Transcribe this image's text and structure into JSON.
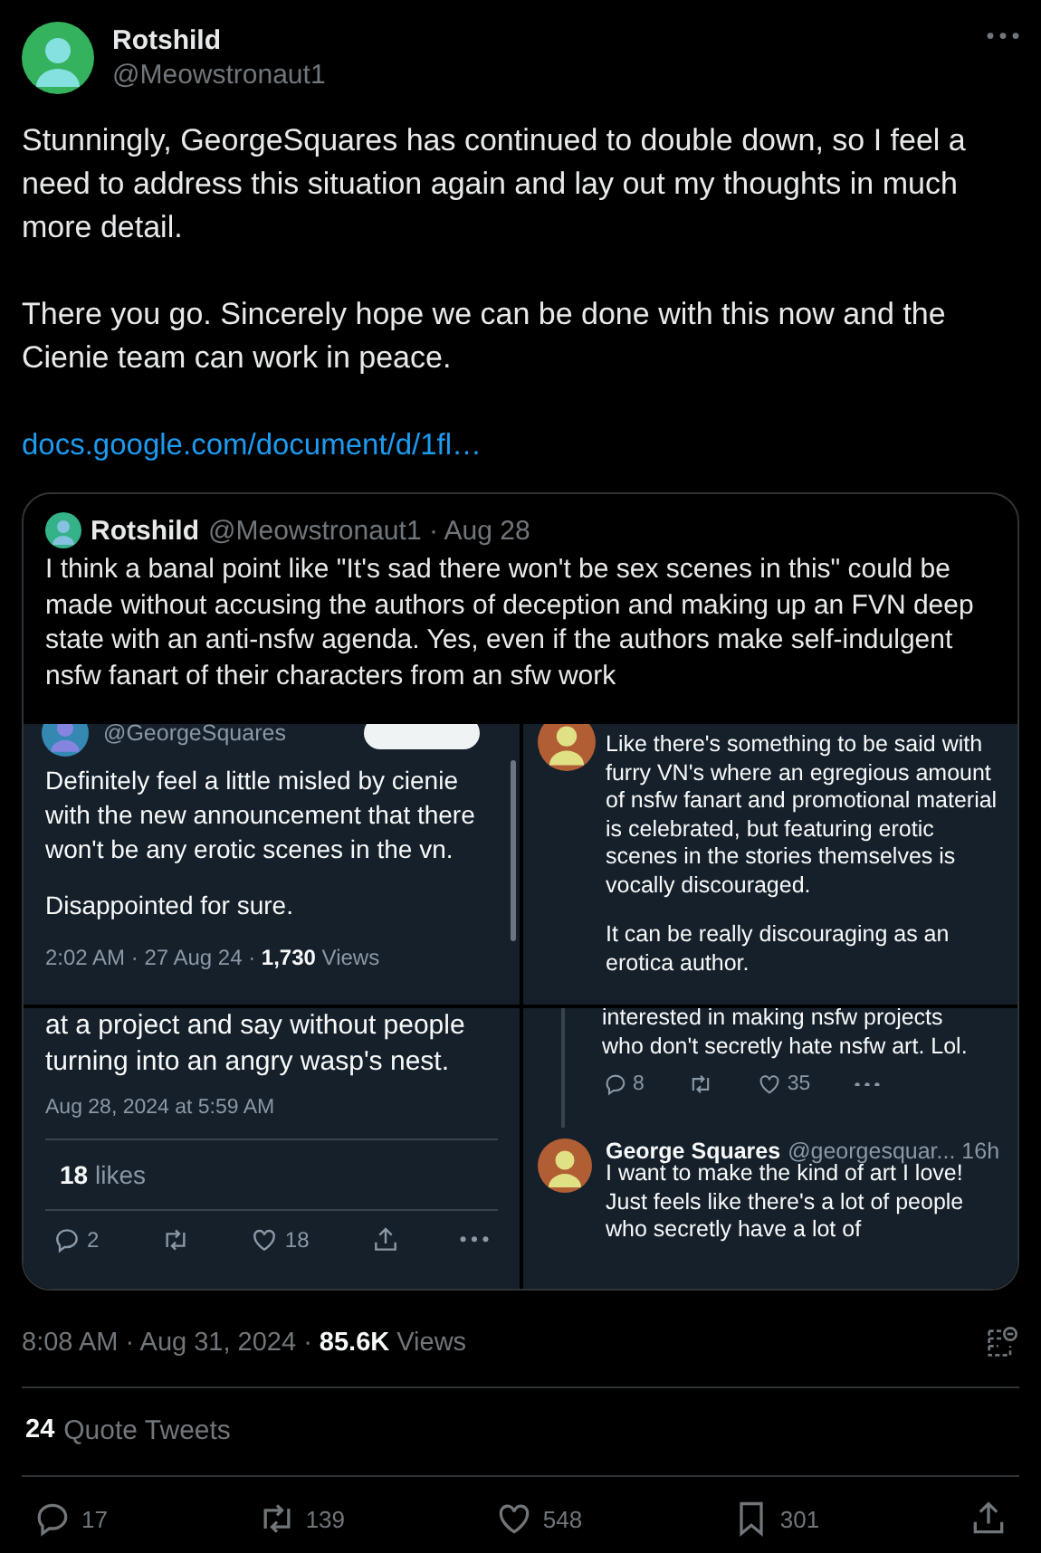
{
  "tweet": {
    "author": {
      "name": "Rotshild",
      "handle": "@Meowstronaut1"
    },
    "paragraphs": [
      "Stunningly, GeorgeSquares has continued to double down, so I feel a need to address this situation again and lay out my thoughts in much more detail.",
      "There you go. Sincerely hope we can be done with this now and the Cienie team can work in peace."
    ],
    "link": "docs.google.com/document/d/1fl…",
    "quote": {
      "name": "Rotshild",
      "meta": "@Meowstronaut1 · Aug 28",
      "text": "I think a banal point like \"It's sad there won't be sex scenes in this\" could be made without accusing the authors of deception and making up an FVN deep state with an anti-nsfw agenda. Yes, even if the authors make self-indulgent nsfw fanart of their characters from an sfw work",
      "screenshots": [
        {
          "kind": "post_top",
          "handle": "@GeorgeSquares",
          "paragraphs": [
            "Definitely feel a little misled by cienie with the new announcement that there won't be any erotic scenes in the vn.",
            "Disappointed for sure."
          ],
          "time": "2:02 AM · 27 Aug 24 ·",
          "views": "1,730",
          "views_label": "Views"
        },
        {
          "kind": "reply_top",
          "paragraphs": [
            "Like there's something to be said with furry VN's where an egregious amount of nsfw fanart and promotional material is celebrated, but featuring erotic scenes in the stories themselves is vocally discouraged.",
            "It can be really discouraging as an erotica author."
          ]
        },
        {
          "kind": "post_bottom",
          "paragraphs": [
            "at a project and say without people turning into an angry wasp's nest."
          ],
          "time": "Aug 28, 2024 at 5:59 AM",
          "likes": "18",
          "likes_label": "likes",
          "actions": [
            {
              "kind": "reply",
              "count": "2"
            },
            {
              "kind": "retweet"
            },
            {
              "kind": "like",
              "count": "18"
            },
            {
              "kind": "share"
            },
            {
              "kind": "more"
            }
          ]
        },
        {
          "kind": "reply_bottom",
          "paragraphs": [
            "interested in making nsfw projects who don't secretly hate nsfw art. Lol."
          ],
          "actions": [
            {
              "kind": "reply",
              "count": "8"
            },
            {
              "kind": "retweet"
            },
            {
              "kind": "like",
              "count": "35"
            },
            {
              "kind": "more"
            }
          ],
          "reply": {
            "name": "George Squares",
            "meta": "@georgesquar... 16h",
            "text": "I want to make the kind of art I love! Just feels like there's a lot of people who secretly have a lot of"
          }
        }
      ]
    },
    "time": "8:08 AM · Aug 31, 2024 ·",
    "views": "85.6K",
    "views_label": "Views",
    "quote_tweets": {
      "count": "24",
      "label": "Quote Tweets"
    },
    "actions": [
      {
        "kind": "reply",
        "count": "17"
      },
      {
        "kind": "retweet",
        "count": "139"
      },
      {
        "kind": "like",
        "count": "548"
      },
      {
        "kind": "bookmark",
        "count": "301"
      },
      {
        "kind": "share"
      }
    ]
  }
}
